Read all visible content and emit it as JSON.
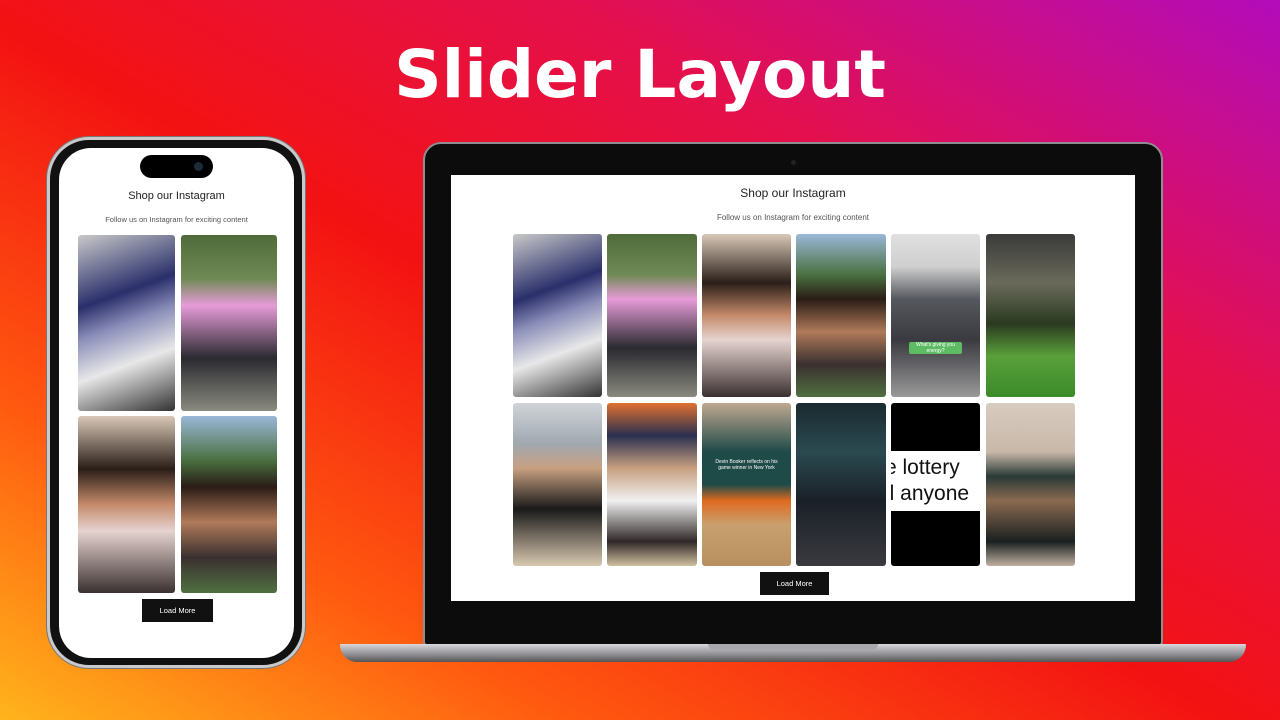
{
  "headline": "Slider Layout",
  "section": {
    "title": "Shop our Instagram",
    "subtitle": "Follow us on Instagram for exciting content",
    "load_more": "Load More"
  },
  "tiles": [
    {
      "subject": "sneaker moodboard",
      "caption": ""
    },
    {
      "subject": "man in pink shirt",
      "caption": ""
    },
    {
      "subject": "woman with shoes",
      "caption": ""
    },
    {
      "subject": "woman laughing outdoors",
      "caption": ""
    },
    {
      "subject": "woman in grey jacket",
      "caption": "What's giving you energy?"
    },
    {
      "subject": "green turf room",
      "caption": ""
    },
    {
      "subject": "woman with microphone",
      "caption": ""
    },
    {
      "subject": "All-Star interview",
      "caption": ""
    },
    {
      "subject": "basketball player",
      "caption": "Devin Booker reflects on his game winner in New York"
    },
    {
      "subject": "photo shoot",
      "caption": ""
    },
    {
      "subject": "text video",
      "caption_line1": "e lottery",
      "caption_line2": "ll anyone"
    },
    {
      "subject": "woman posing",
      "caption": ""
    }
  ],
  "colors": {
    "button": "#111111",
    "background_start": "#ffb41c",
    "background_mid": "#f31212",
    "background_end": "#b20cba"
  }
}
